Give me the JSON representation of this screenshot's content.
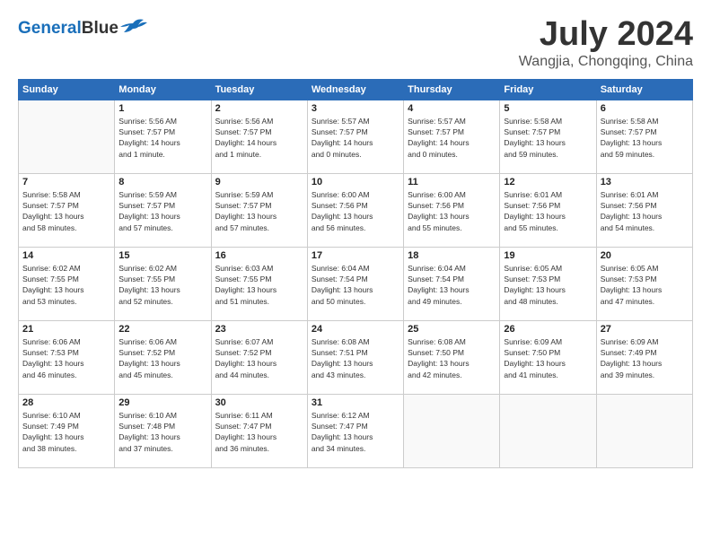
{
  "header": {
    "logo_general": "General",
    "logo_blue": "Blue",
    "month_title": "July 2024",
    "location": "Wangjia, Chongqing, China"
  },
  "weekdays": [
    "Sunday",
    "Monday",
    "Tuesday",
    "Wednesday",
    "Thursday",
    "Friday",
    "Saturday"
  ],
  "weeks": [
    [
      {
        "day": "",
        "info": ""
      },
      {
        "day": "1",
        "info": "Sunrise: 5:56 AM\nSunset: 7:57 PM\nDaylight: 14 hours\nand 1 minute."
      },
      {
        "day": "2",
        "info": "Sunrise: 5:56 AM\nSunset: 7:57 PM\nDaylight: 14 hours\nand 1 minute."
      },
      {
        "day": "3",
        "info": "Sunrise: 5:57 AM\nSunset: 7:57 PM\nDaylight: 14 hours\nand 0 minutes."
      },
      {
        "day": "4",
        "info": "Sunrise: 5:57 AM\nSunset: 7:57 PM\nDaylight: 14 hours\nand 0 minutes."
      },
      {
        "day": "5",
        "info": "Sunrise: 5:58 AM\nSunset: 7:57 PM\nDaylight: 13 hours\nand 59 minutes."
      },
      {
        "day": "6",
        "info": "Sunrise: 5:58 AM\nSunset: 7:57 PM\nDaylight: 13 hours\nand 59 minutes."
      }
    ],
    [
      {
        "day": "7",
        "info": "Sunrise: 5:58 AM\nSunset: 7:57 PM\nDaylight: 13 hours\nand 58 minutes."
      },
      {
        "day": "8",
        "info": "Sunrise: 5:59 AM\nSunset: 7:57 PM\nDaylight: 13 hours\nand 57 minutes."
      },
      {
        "day": "9",
        "info": "Sunrise: 5:59 AM\nSunset: 7:57 PM\nDaylight: 13 hours\nand 57 minutes."
      },
      {
        "day": "10",
        "info": "Sunrise: 6:00 AM\nSunset: 7:56 PM\nDaylight: 13 hours\nand 56 minutes."
      },
      {
        "day": "11",
        "info": "Sunrise: 6:00 AM\nSunset: 7:56 PM\nDaylight: 13 hours\nand 55 minutes."
      },
      {
        "day": "12",
        "info": "Sunrise: 6:01 AM\nSunset: 7:56 PM\nDaylight: 13 hours\nand 55 minutes."
      },
      {
        "day": "13",
        "info": "Sunrise: 6:01 AM\nSunset: 7:56 PM\nDaylight: 13 hours\nand 54 minutes."
      }
    ],
    [
      {
        "day": "14",
        "info": "Sunrise: 6:02 AM\nSunset: 7:55 PM\nDaylight: 13 hours\nand 53 minutes."
      },
      {
        "day": "15",
        "info": "Sunrise: 6:02 AM\nSunset: 7:55 PM\nDaylight: 13 hours\nand 52 minutes."
      },
      {
        "day": "16",
        "info": "Sunrise: 6:03 AM\nSunset: 7:55 PM\nDaylight: 13 hours\nand 51 minutes."
      },
      {
        "day": "17",
        "info": "Sunrise: 6:04 AM\nSunset: 7:54 PM\nDaylight: 13 hours\nand 50 minutes."
      },
      {
        "day": "18",
        "info": "Sunrise: 6:04 AM\nSunset: 7:54 PM\nDaylight: 13 hours\nand 49 minutes."
      },
      {
        "day": "19",
        "info": "Sunrise: 6:05 AM\nSunset: 7:53 PM\nDaylight: 13 hours\nand 48 minutes."
      },
      {
        "day": "20",
        "info": "Sunrise: 6:05 AM\nSunset: 7:53 PM\nDaylight: 13 hours\nand 47 minutes."
      }
    ],
    [
      {
        "day": "21",
        "info": "Sunrise: 6:06 AM\nSunset: 7:53 PM\nDaylight: 13 hours\nand 46 minutes."
      },
      {
        "day": "22",
        "info": "Sunrise: 6:06 AM\nSunset: 7:52 PM\nDaylight: 13 hours\nand 45 minutes."
      },
      {
        "day": "23",
        "info": "Sunrise: 6:07 AM\nSunset: 7:52 PM\nDaylight: 13 hours\nand 44 minutes."
      },
      {
        "day": "24",
        "info": "Sunrise: 6:08 AM\nSunset: 7:51 PM\nDaylight: 13 hours\nand 43 minutes."
      },
      {
        "day": "25",
        "info": "Sunrise: 6:08 AM\nSunset: 7:50 PM\nDaylight: 13 hours\nand 42 minutes."
      },
      {
        "day": "26",
        "info": "Sunrise: 6:09 AM\nSunset: 7:50 PM\nDaylight: 13 hours\nand 41 minutes."
      },
      {
        "day": "27",
        "info": "Sunrise: 6:09 AM\nSunset: 7:49 PM\nDaylight: 13 hours\nand 39 minutes."
      }
    ],
    [
      {
        "day": "28",
        "info": "Sunrise: 6:10 AM\nSunset: 7:49 PM\nDaylight: 13 hours\nand 38 minutes."
      },
      {
        "day": "29",
        "info": "Sunrise: 6:10 AM\nSunset: 7:48 PM\nDaylight: 13 hours\nand 37 minutes."
      },
      {
        "day": "30",
        "info": "Sunrise: 6:11 AM\nSunset: 7:47 PM\nDaylight: 13 hours\nand 36 minutes."
      },
      {
        "day": "31",
        "info": "Sunrise: 6:12 AM\nSunset: 7:47 PM\nDaylight: 13 hours\nand 34 minutes."
      },
      {
        "day": "",
        "info": ""
      },
      {
        "day": "",
        "info": ""
      },
      {
        "day": "",
        "info": ""
      }
    ]
  ]
}
